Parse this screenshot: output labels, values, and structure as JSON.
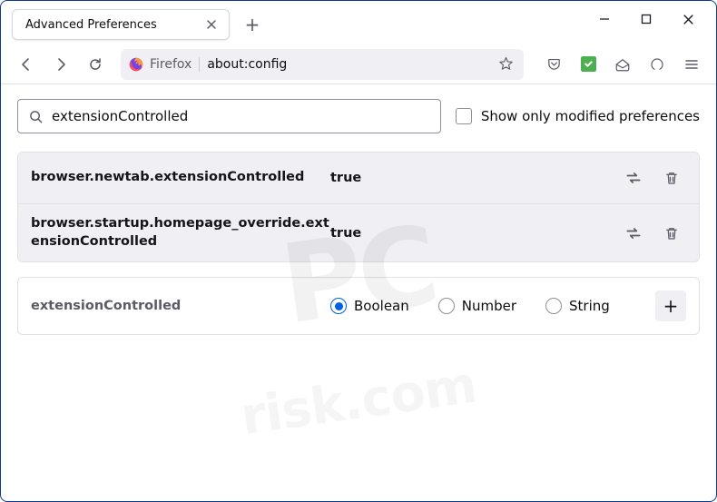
{
  "window": {
    "tab_title": "Advanced Preferences"
  },
  "toolbar": {
    "identity_label": "Firefox",
    "url": "about:config"
  },
  "search": {
    "value": "extensionControlled",
    "show_modified_label": "Show only modified preferences",
    "show_modified_checked": false
  },
  "prefs": [
    {
      "name": "browser.newtab.extensionControlled",
      "value": "true"
    },
    {
      "name": "browser.startup.homepage_override.extensionControlled",
      "value": "true"
    }
  ],
  "add": {
    "name": "extensionControlled",
    "types": [
      "Boolean",
      "Number",
      "String"
    ],
    "selected": "Boolean"
  },
  "icons": {
    "toggle": "toggle-icon",
    "trash": "trash-icon",
    "plus": "+"
  },
  "watermark": {
    "big": "PC",
    "small": "risk.com"
  }
}
